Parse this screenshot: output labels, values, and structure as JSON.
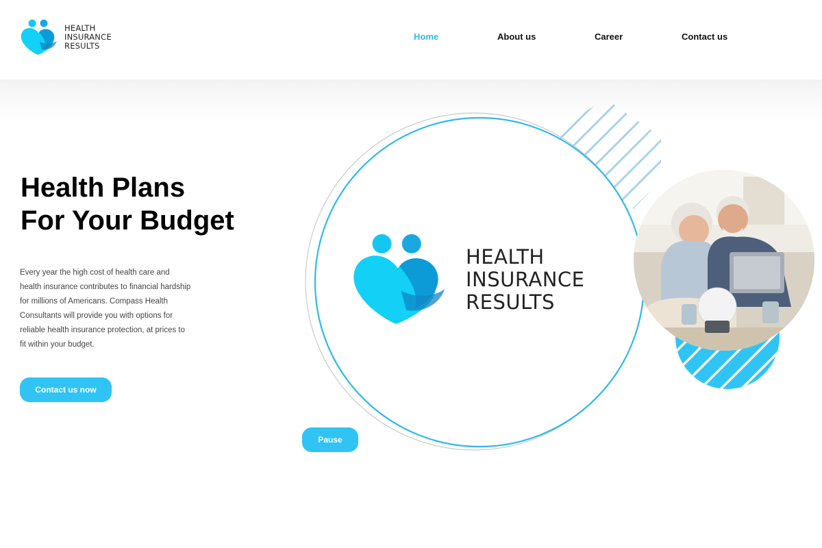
{
  "brand": {
    "name_line1": "HEALTH",
    "name_line2": "INSURANCE",
    "name_line3": "RESULTS",
    "primary_color": "#2fc4f4",
    "accent_color": "#00a6e6"
  },
  "nav": {
    "items": [
      {
        "label": "Home",
        "active": true
      },
      {
        "label": "About us",
        "active": false
      },
      {
        "label": "Career",
        "active": false
      },
      {
        "label": "Contact us",
        "active": false
      }
    ]
  },
  "hero": {
    "title_line1": "Health Plans",
    "title_line2": "For Your Budget",
    "description": "Every year the high cost of health care and health insurance contributes to financial hardship for millions of Americans. Compass Health Consultants will provide you with options for reliable health insurance protection, at prices to fit within your budget.",
    "cta_label": "Contact us now"
  },
  "slider": {
    "pause_label": "Pause"
  },
  "icons": {
    "logo": "heart-people-logo-icon",
    "photo": "senior-couple-laptop-photo"
  }
}
